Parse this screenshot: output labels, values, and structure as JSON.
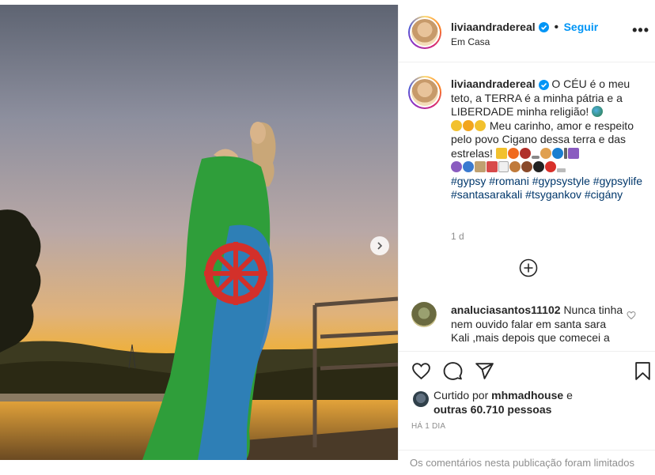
{
  "post": {
    "username": "liviaandradereal",
    "follow_label": "Seguir",
    "location": "Em Casa",
    "more_options": "•••"
  },
  "caption": {
    "username": "liviaandradereal",
    "line1": "O CÉU é o meu teto, a TERRA é a minha pátria e a LIBERDADE minha religião!",
    "line2": "Meu carinho, amor e respeito pelo povo Cigano dessa terra e das estrelas!",
    "hashtags": [
      "#gypsy",
      "#romani",
      "#gypsystyle",
      "#gypsylife",
      "#santasarakali",
      "#tsygankov",
      "#cigány"
    ],
    "time": "1 d"
  },
  "comment": {
    "username": "analuciasantos11102",
    "text": "Nunca tinha nem ouvido falar em santa sara Kali ,mais depois que comecei a"
  },
  "likes": {
    "prefix": "Curtido por",
    "user": "mhmadhouse",
    "conj": "e",
    "others": "outras 60.710 pessoas"
  },
  "date": "HÁ 1 DIA",
  "comments_limited": "Os comentários nesta publicação foram limitados",
  "icons": {
    "heart": "heart-icon",
    "comment": "comment-icon",
    "share": "share-icon",
    "save": "bookmark-icon",
    "add": "plus-circle-icon",
    "next": "chevron-right-icon",
    "verified": "verified-badge-icon"
  },
  "colors": {
    "link": "#0095f6",
    "hashtag": "#00376b",
    "muted": "#8e8e8e",
    "verified": "#0095f6"
  }
}
